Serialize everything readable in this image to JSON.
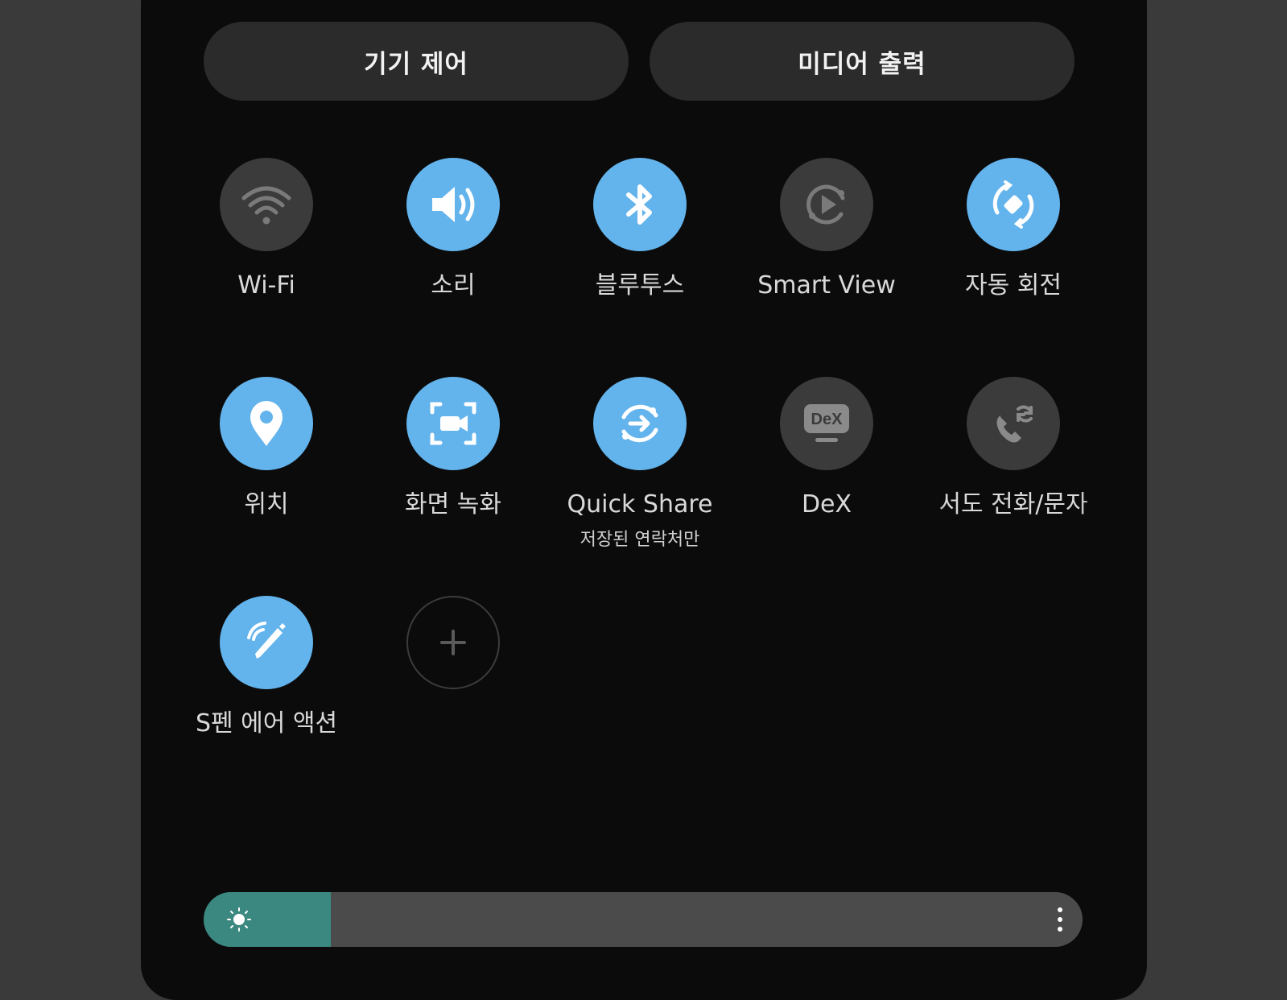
{
  "top_buttons": {
    "device_control": "기기 제어",
    "media_output": "미디어 출력"
  },
  "tiles": [
    {
      "label": "Wi-Fi",
      "state": "off",
      "icon": "wifi-icon"
    },
    {
      "label": "소리",
      "state": "on",
      "icon": "sound-icon"
    },
    {
      "label": "블루투스",
      "state": "on",
      "icon": "bluetooth-icon"
    },
    {
      "label": "Smart View",
      "state": "off",
      "icon": "smart-view-icon"
    },
    {
      "label": "자동 회전",
      "state": "on",
      "icon": "auto-rotate-icon"
    },
    {
      "label": "위치",
      "state": "on",
      "icon": "location-icon"
    },
    {
      "label": "화면 녹화",
      "state": "on",
      "icon": "screen-record-icon"
    },
    {
      "label": "Quick Share",
      "sublabel": "저장된 연락처만",
      "state": "on",
      "icon": "quick-share-icon"
    },
    {
      "label": "DeX",
      "state": "off",
      "icon": "dex-icon",
      "icon_text": "DeX"
    },
    {
      "label": "서도 전화/문자",
      "state": "off",
      "icon": "call-sync-icon"
    },
    {
      "label": "S펜 에어 액션",
      "state": "on",
      "icon": "s-pen-air-action-icon"
    },
    {
      "label": "",
      "state": "add",
      "icon": "add-icon"
    }
  ],
  "brightness": {
    "level": 0.145,
    "fill_color": "#3a8880"
  },
  "colors": {
    "tile_on": "#63b3ec",
    "tile_off": "#3b3b3b",
    "panel_bg": "#0b0b0b",
    "button_bg": "#2b2b2b"
  }
}
